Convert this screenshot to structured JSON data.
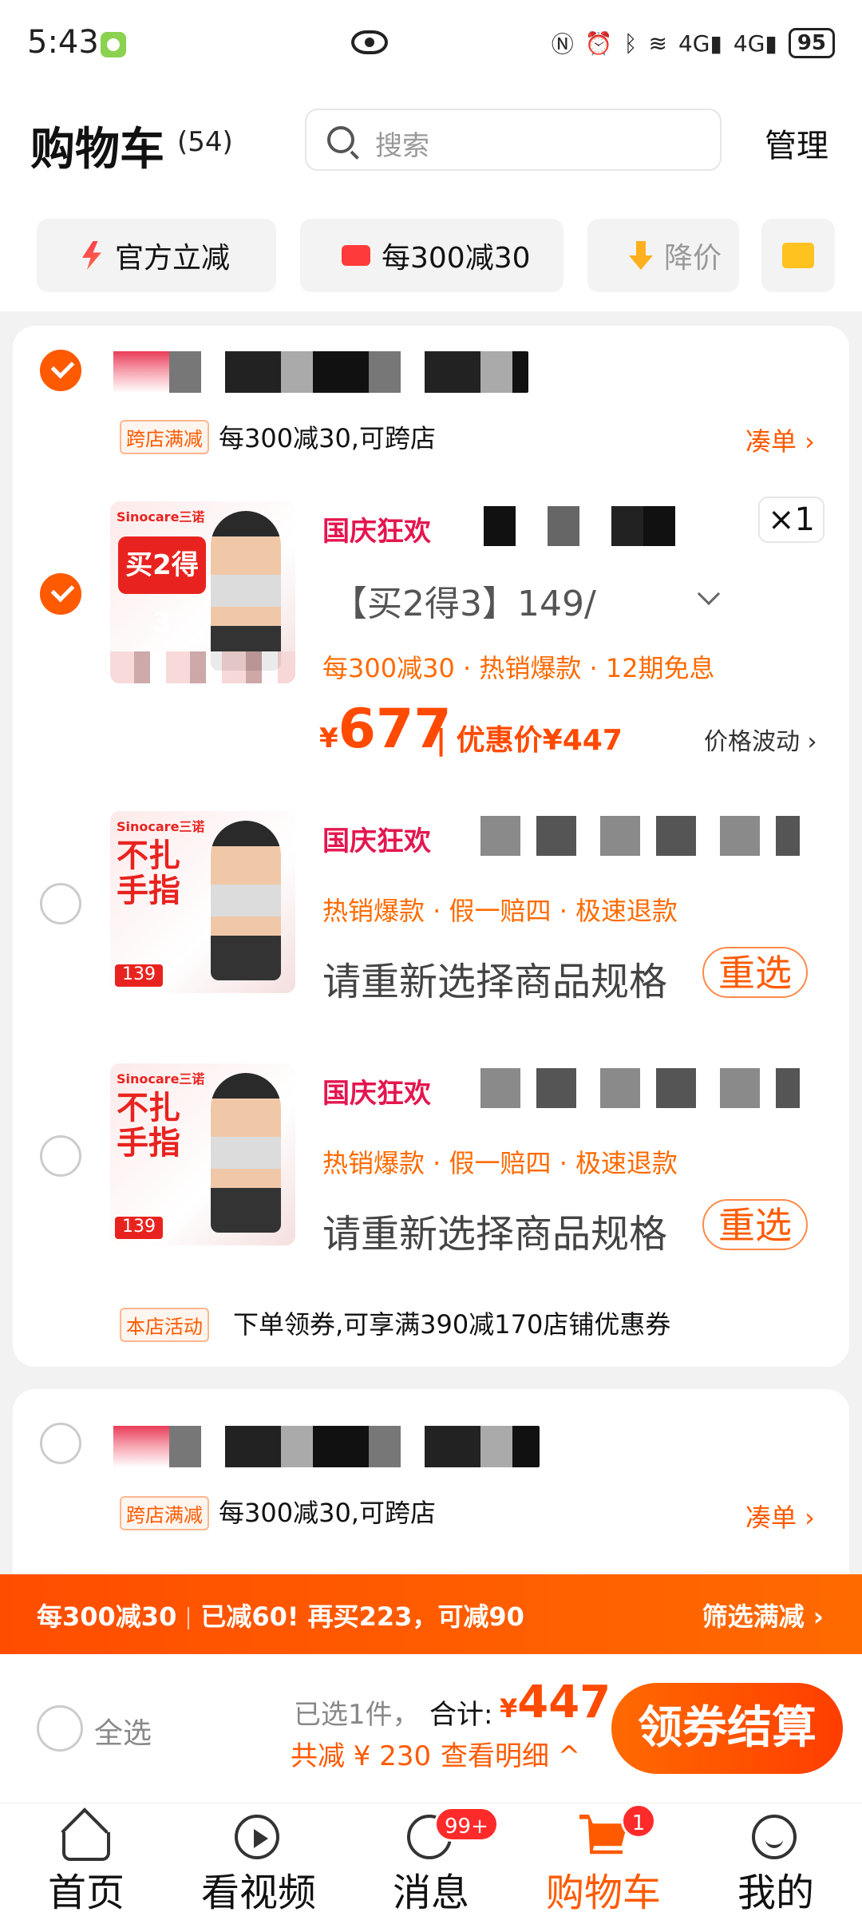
{
  "status_bar": {
    "time": "5:43",
    "battery": "95",
    "net1": "4G",
    "net2": "4G"
  },
  "header": {
    "title": "购物车",
    "count": "(54)",
    "search_placeholder": "搜索",
    "manage": "管理"
  },
  "chips": [
    {
      "label": "官方立减",
      "icon": "bolt-icon"
    },
    {
      "label": "每300减30",
      "icon": "gift-box-icon"
    },
    {
      "label": "降价",
      "icon": "price-drop-icon"
    },
    {
      "label": "",
      "icon": "folder-icon"
    }
  ],
  "shop1": {
    "tag": "跨店满减",
    "promo": "每300减30,可跨店",
    "add_on": "凑单 ›",
    "items": [
      {
        "checked": true,
        "event": "国庆狂欢",
        "qty": "×1",
        "spec": "【买2得3】149/",
        "features": "每300减30 · 热销爆款 · 12期免息",
        "price_currency": "¥",
        "price": "677",
        "discount_label": "| 优惠价¥447",
        "fluctuation": "价格波动 ›",
        "img_brand": "Sinocare三诺",
        "img_badge": "买2得3"
      },
      {
        "checked": false,
        "event": "国庆狂欢",
        "features": "热销爆款 · 假一赔四 · 极速退款",
        "reselect_text": "请重新选择商品规格",
        "reselect_btn": "重选",
        "img_brand": "Sinocare三诺",
        "img_big": "不扎手指",
        "img_price": "139"
      },
      {
        "checked": false,
        "event": "国庆狂欢",
        "features": "热销爆款 · 假一赔四 · 极速退款",
        "reselect_text": "请重新选择商品规格",
        "reselect_btn": "重选",
        "img_brand": "Sinocare三诺",
        "img_big": "不扎手指",
        "img_price": "139"
      }
    ],
    "store_tag": "本店活动",
    "store_promo": "下单领券,可享满390减170店铺优惠券"
  },
  "shop2": {
    "tag": "跨店满减",
    "promo": "每300减30,可跨店",
    "add_on": "凑单 ›"
  },
  "promo_bar": {
    "left1": "每300减30",
    "left2": "已减60!  再买223，可减90",
    "right": "筛选满减 ›"
  },
  "checkout": {
    "select_all": "全选",
    "selected": "已选1件，",
    "total_label": "合计:",
    "total_currency": "¥",
    "total": "447",
    "saved": "共减 ¥ 230",
    "detail": "查看明细 ^",
    "button": "领券结算"
  },
  "nav": [
    {
      "label": "首页",
      "icon": "home-icon"
    },
    {
      "label": "看视频",
      "icon": "play-icon"
    },
    {
      "label": "消息",
      "icon": "message-icon",
      "badge": "99+"
    },
    {
      "label": "购物车",
      "icon": "cart-icon",
      "badge": "1",
      "active": true
    },
    {
      "label": "我的",
      "icon": "profile-icon"
    }
  ],
  "colors": {
    "accent": "#ff5a00",
    "event": "#e4164f",
    "price": "#ff4a00"
  }
}
